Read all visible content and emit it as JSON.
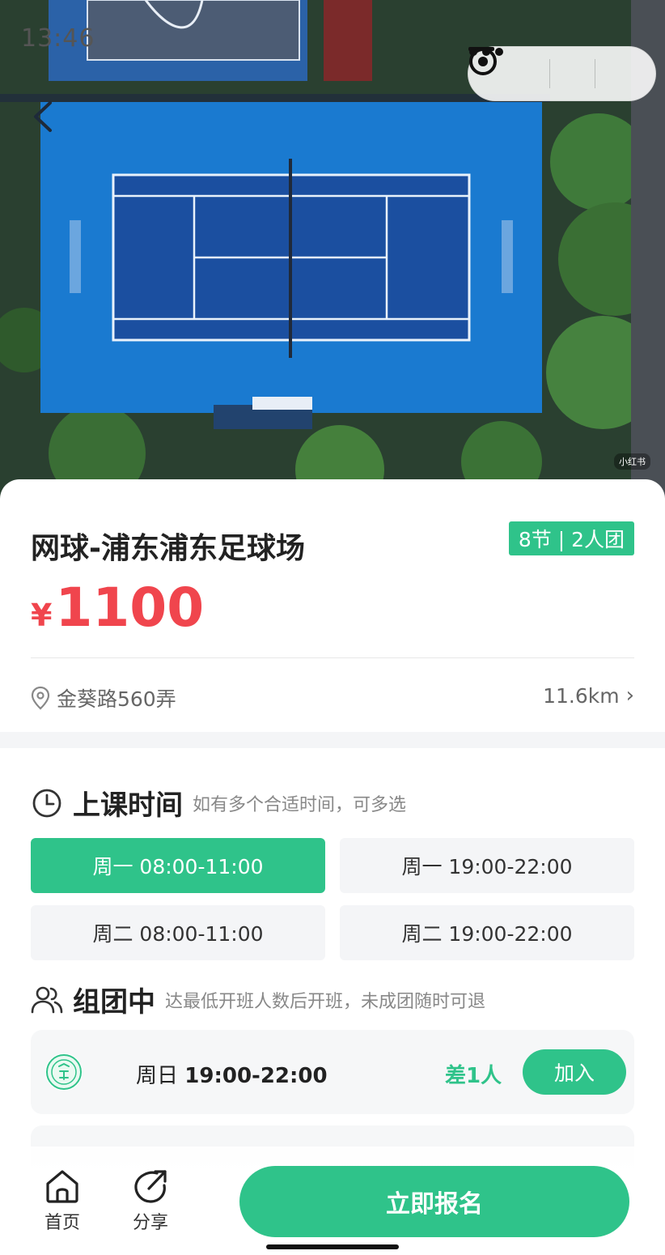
{
  "status_bar": {
    "time": "13:46"
  },
  "hero": {
    "watermark": "小红书"
  },
  "course": {
    "title": "网球-浦东浦东足球场",
    "tag": "8节 | 2人团",
    "currency": "¥",
    "price": "1100",
    "address": "金葵路560弄",
    "distance": "11.6km"
  },
  "schedule": {
    "heading": "上课时间",
    "hint": "如有多个合适时间，可多选",
    "slots": [
      {
        "label": "周一 08:00-11:00",
        "selected": true
      },
      {
        "label": "周一 19:00-22:00",
        "selected": false
      },
      {
        "label": "周二 08:00-11:00",
        "selected": false
      },
      {
        "label": "周二 19:00-22:00",
        "selected": false
      }
    ]
  },
  "groups": {
    "heading": "组团中",
    "hint": "达最低开班人数后开班，未成团随时可退",
    "items": [
      {
        "day": "周日",
        "time": "19:00-22:00",
        "need": "差1人",
        "join_label": "加入"
      }
    ]
  },
  "bottom_bar": {
    "home_label": "首页",
    "share_label": "分享",
    "signup_label": "立即报名"
  },
  "colors": {
    "accent": "#2fc38a",
    "price": "#f0454d",
    "court": "#1a7ad0"
  },
  "icons": [
    "chevron-left-icon",
    "more-dots-icon",
    "minimize-icon",
    "target-icon",
    "location-pin-icon",
    "chevron-right-icon",
    "clock-icon",
    "users-icon",
    "home-icon",
    "share-icon"
  ]
}
